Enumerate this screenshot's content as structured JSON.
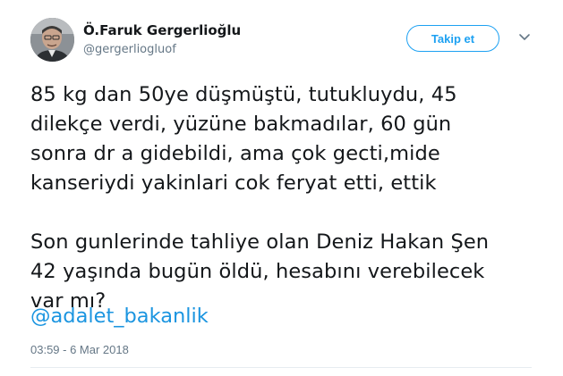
{
  "user": {
    "name": "Ö.Faruk Gergerlioğlu",
    "handle": "@gergerliogluof"
  },
  "follow_button_label": "Takip et",
  "icons": {
    "avatar": "profile-photo",
    "caret": "chevron-down-icon"
  },
  "tweet": {
    "paragraph_1": "85 kg dan 50ye düşmüştü, tutukluydu, 45\ndilekçe verdi, yüzüne bakmadılar, 60 gün\nsonra dr a gidebildi, ama çok gecti,mide\nkanseriydi yakinlari cok feryat etti, ettik",
    "paragraph_2": "Son gunlerinde tahliye olan Deniz Hakan Şen\n42 yaşında bugün öldü,  hesabını verebilecek\nvar mı?",
    "mention": "@adalet_bakanlik"
  },
  "timestamp": "03:59 - 6 Mar 2018",
  "colors": {
    "accent": "#1da1f2",
    "mention": "#1b95e0",
    "text": "#14171a",
    "secondary": "#657786"
  }
}
